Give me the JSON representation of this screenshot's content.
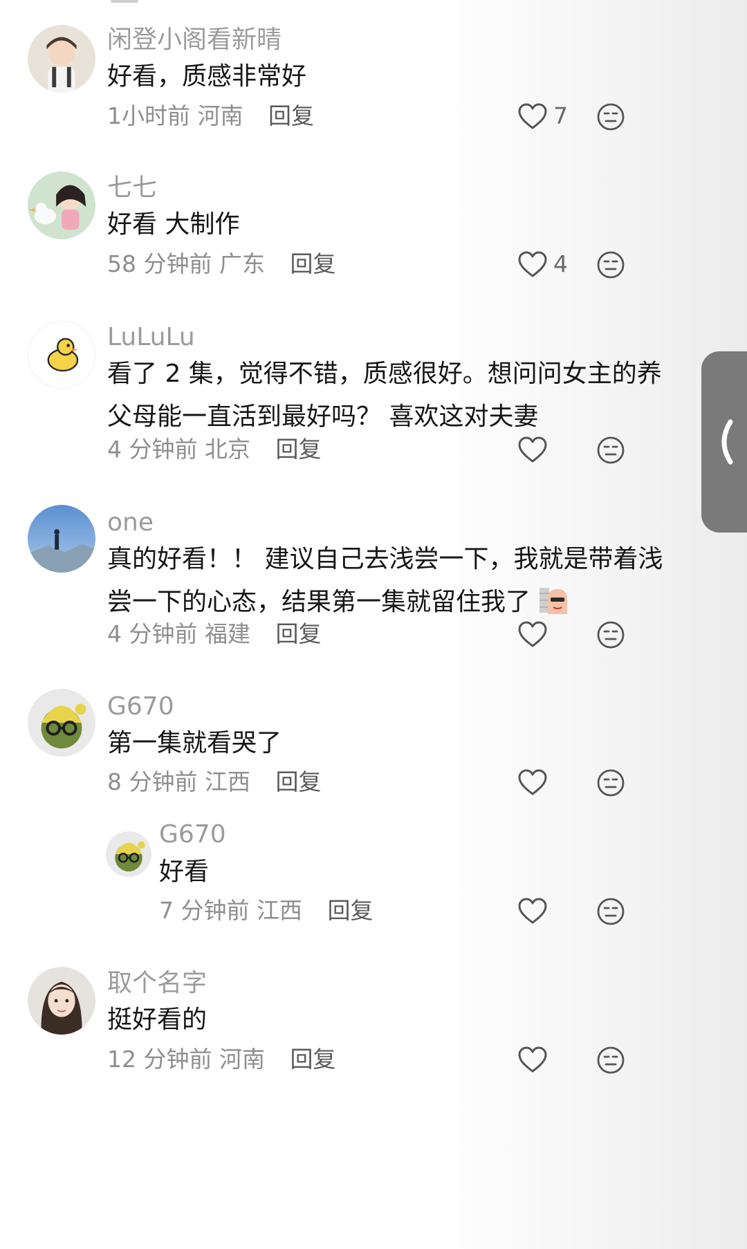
{
  "comments": [
    {
      "username": "闲登小阁看新晴",
      "text": "好看，质感非常好",
      "time": "1小时前",
      "location": "河南",
      "reply_label": "回复",
      "likes": "7"
    },
    {
      "username": "七七",
      "text": "好看 大制作",
      "time": "58 分钟前",
      "location": "广东",
      "reply_label": "回复",
      "likes": "4"
    },
    {
      "username": "LuLuLu",
      "text_line1": "看了 2 集，觉得不错，质感很好。想问问女主的养",
      "text_line2": "父母能一直活到最好吗？ 喜欢这对夫妻",
      "time": "4 分钟前",
      "location": "北京",
      "reply_label": "回复",
      "likes": ""
    },
    {
      "username": "one",
      "text_line1": "真的好看！！ 建议自己去浅尝一下，我就是带着浅",
      "text_line2": "尝一下的心态，结果第一集就留住我了",
      "time": "4 分钟前",
      "location": "福建",
      "reply_label": "回复",
      "likes": ""
    },
    {
      "username": "G670",
      "text": "第一集就看哭了",
      "time": "8 分钟前",
      "location": "江西",
      "reply_label": "回复",
      "likes": ""
    },
    {
      "username": "G670",
      "text": "好看",
      "time": "7 分钟前",
      "location": "江西",
      "reply_label": "回复",
      "likes": ""
    },
    {
      "username": "取个名字",
      "text": "挺好看的",
      "time": "12 分钟前",
      "location": "河南",
      "reply_label": "回复",
      "likes": ""
    }
  ],
  "colors": {
    "username": "#9b9b9b",
    "text": "#161616",
    "meta": "#8e8e8e",
    "side_tab": "#7a7a7a"
  },
  "icons": {
    "like": "heart-outline-icon",
    "dislike": "neutral-face-icon",
    "side_tab": "chevron-left-icon"
  }
}
